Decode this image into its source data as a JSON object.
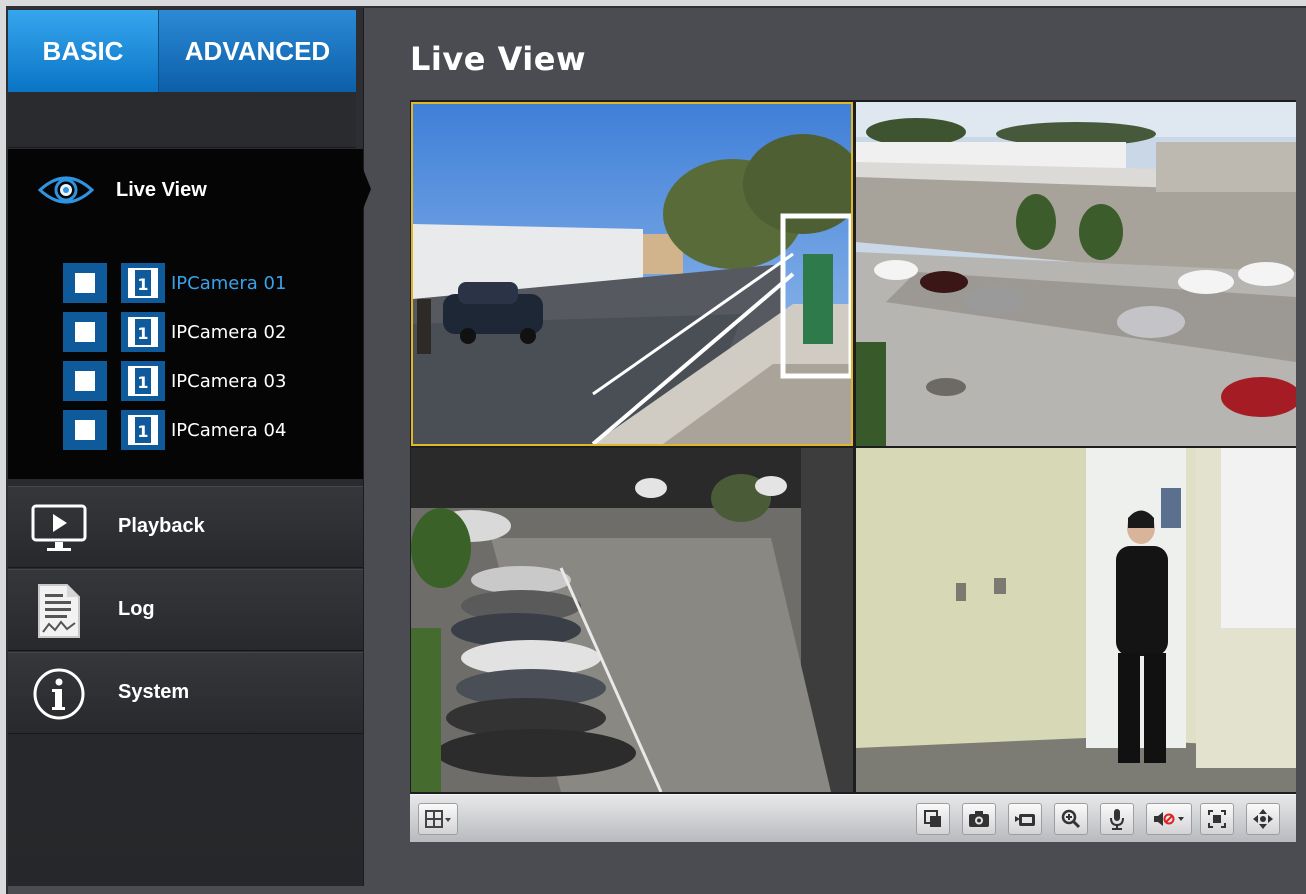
{
  "tabs": {
    "basic": "BASIC",
    "advanced": "ADVANCED"
  },
  "sidebar": {
    "live_view": {
      "label": "Live View",
      "cameras": [
        {
          "label": "IPCamera 01",
          "active": true
        },
        {
          "label": "IPCamera 02",
          "active": false
        },
        {
          "label": "IPCamera 03",
          "active": false
        },
        {
          "label": "IPCamera 04",
          "active": false
        }
      ]
    },
    "items": [
      {
        "label": "Playback",
        "icon": "monitor-play-icon"
      },
      {
        "label": "Log",
        "icon": "log-document-icon"
      },
      {
        "label": "System",
        "icon": "info-icon"
      }
    ]
  },
  "main": {
    "title": "Live View"
  },
  "toolbar": {
    "layout": "layout-grid-icon",
    "actions": [
      "fullscreen-icon",
      "snapshot-icon",
      "record-icon",
      "zoom-icon",
      "microphone-icon",
      "speaker-mute-icon",
      "fit-screen-icon",
      "ptz-icon"
    ]
  },
  "colors": {
    "accent": "#1b8ee0",
    "selected_border": "#e0b62a",
    "active_camera": "#3aa2ea"
  }
}
